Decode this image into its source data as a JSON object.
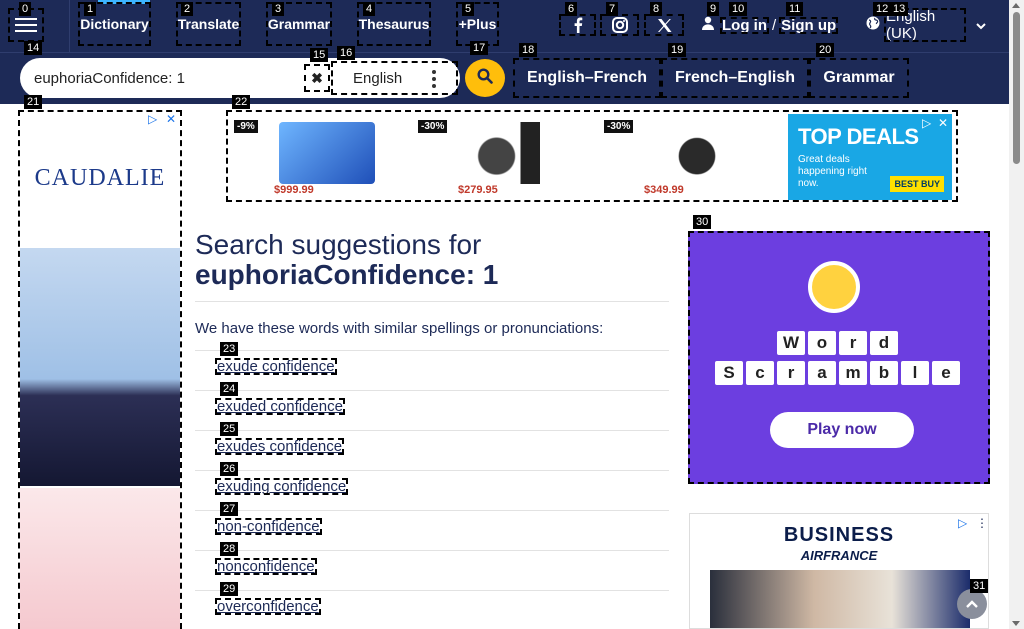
{
  "nav": {
    "items": [
      {
        "label": "Dictionary"
      },
      {
        "label": "Translate"
      },
      {
        "label": "Grammar"
      },
      {
        "label": "Thesaurus"
      },
      {
        "label": "+Plus"
      }
    ],
    "login": "Log in",
    "slash": "/",
    "signup": "Sign up",
    "language": "English (UK)"
  },
  "badges": [
    "0",
    "1",
    "2",
    "3",
    "4",
    "5",
    "6",
    "7",
    "8",
    "9",
    "10",
    "11",
    "12",
    "13",
    "14",
    "15",
    "16",
    "17",
    "18",
    "19",
    "20",
    "21",
    "22",
    "23",
    "24",
    "25",
    "26",
    "27",
    "28",
    "29",
    "30",
    "31"
  ],
  "search": {
    "value": "euphoriaConfidence: 1",
    "dictionary": "English"
  },
  "tabs": [
    "English–French",
    "French–English",
    "Grammar"
  ],
  "ads": {
    "left_brand": "CAUDALIE",
    "top_products": [
      {
        "discount": "-9%",
        "price": "$999.99"
      },
      {
        "discount": "-30%",
        "price": "$279.95"
      },
      {
        "discount": "-30%",
        "price": "$349.99"
      }
    ],
    "top_deals_title": "TOP DEALS",
    "top_deals_sub": "Great deals happening right now.",
    "best_buy": "BEST BUY",
    "scramble_row1": [
      "W",
      "o",
      "r",
      "d"
    ],
    "scramble_row2": [
      "S",
      "c",
      "r",
      "a",
      "m",
      "b",
      "l",
      "e"
    ],
    "play_now": "Play now",
    "af_title": "BUSINESS",
    "af_sub": "AIRFRANCE"
  },
  "results": {
    "heading_prefix": "Search suggestions for",
    "heading_term": "euphoriaConfidence: 1",
    "intro": "We have these words with similar spellings or pronunciations:",
    "suggestions": [
      "exude confidence",
      "exuded confidence",
      "exudes confidence",
      "exuding confidence",
      "non-confidence",
      "nonconfidence",
      "overconfidence"
    ]
  }
}
